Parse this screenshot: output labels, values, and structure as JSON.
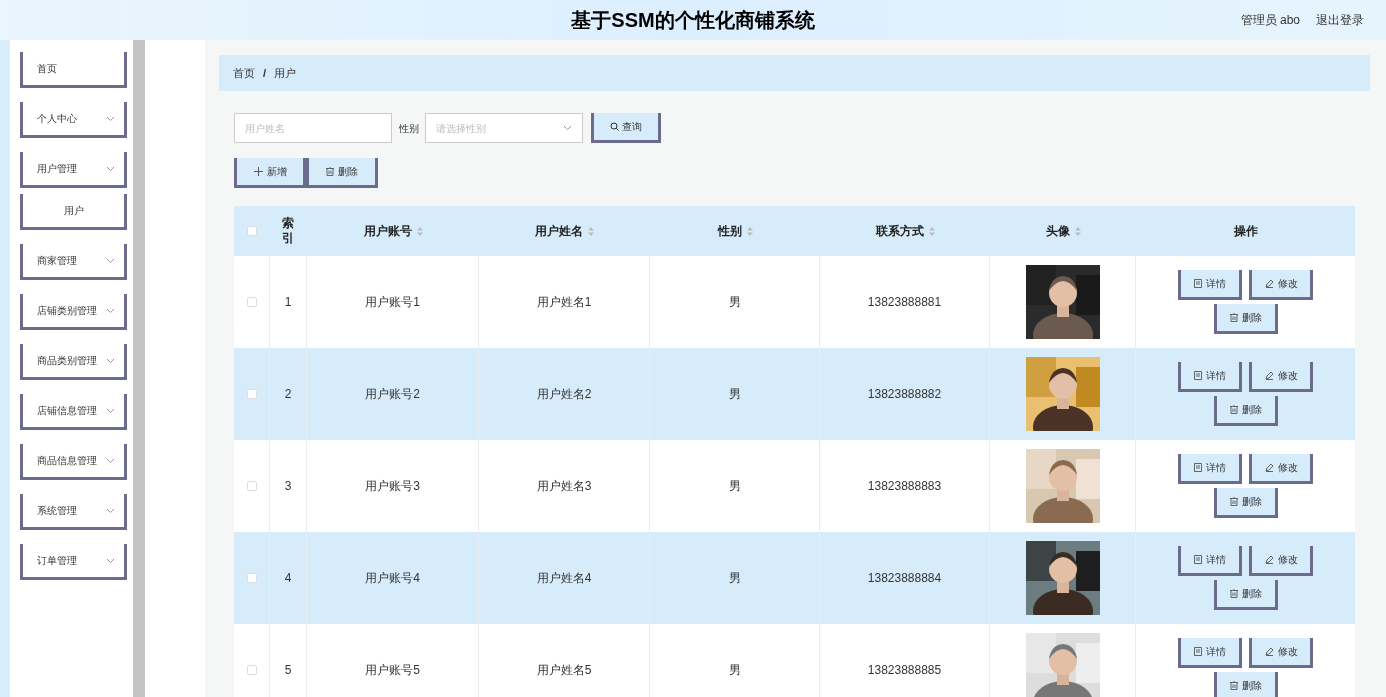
{
  "header": {
    "title": "基于SSM的个性化商铺系统",
    "user": "管理员 abo",
    "logout": "退出登录"
  },
  "sidebar": {
    "items": [
      {
        "label": "首页",
        "kind": "link"
      },
      {
        "label": "个人中心",
        "kind": "menu"
      },
      {
        "label": "用户管理",
        "kind": "menu",
        "children": [
          {
            "label": "用户",
            "kind": "sub"
          }
        ]
      },
      {
        "label": "商家管理",
        "kind": "menu"
      },
      {
        "label": "店铺类别管理",
        "kind": "menu"
      },
      {
        "label": "商品类别管理",
        "kind": "menu"
      },
      {
        "label": "店铺信息管理",
        "kind": "menu"
      },
      {
        "label": "商品信息管理",
        "kind": "menu"
      },
      {
        "label": "系统管理",
        "kind": "menu"
      },
      {
        "label": "订单管理",
        "kind": "menu"
      }
    ]
  },
  "breadcrumb": [
    "首页",
    "用户"
  ],
  "breadcrumb_separator": "/",
  "search": {
    "name_placeholder": "用户姓名",
    "gender_label": "性别",
    "gender_placeholder": "请选择性别",
    "query_button": "查询"
  },
  "toolbar": [
    {
      "label": "新增",
      "kind": "add"
    },
    {
      "label": "删除",
      "kind": "delete"
    }
  ],
  "table": {
    "columns": [
      {
        "label": "索引",
        "kind": "index"
      },
      {
        "label": "用户账号",
        "kind": "text",
        "sortable": true
      },
      {
        "label": "用户姓名",
        "kind": "text",
        "sortable": true
      },
      {
        "label": "性别",
        "kind": "text",
        "sortable": true
      },
      {
        "label": "联系方式",
        "kind": "text",
        "sortable": true
      },
      {
        "label": "头像",
        "kind": "avatar",
        "sortable": true
      },
      {
        "label": "操作",
        "kind": "actions"
      }
    ],
    "header_checked": false,
    "rows": [
      {
        "checked": false,
        "cells": [
          "1",
          "用户账号1",
          "用户姓名1",
          "男",
          "13823888881"
        ],
        "actions": [
          "详情",
          "修改",
          "删除"
        ]
      },
      {
        "checked": false,
        "cells": [
          "2",
          "用户账号2",
          "用户姓名2",
          "男",
          "13823888882"
        ],
        "actions": [
          "详情",
          "修改",
          "删除"
        ]
      },
      {
        "checked": false,
        "cells": [
          "3",
          "用户账号3",
          "用户姓名3",
          "男",
          "13823888883"
        ],
        "actions": [
          "详情",
          "修改",
          "删除"
        ]
      },
      {
        "checked": false,
        "cells": [
          "4",
          "用户账号4",
          "用户姓名4",
          "男",
          "13823888884"
        ],
        "actions": [
          "详情",
          "修改",
          "删除"
        ]
      },
      {
        "checked": false,
        "cells": [
          "5",
          "用户账号5",
          "用户姓名5",
          "男",
          "13823888885"
        ],
        "actions": [
          "详情",
          "修改",
          "删除"
        ]
      }
    ]
  }
}
